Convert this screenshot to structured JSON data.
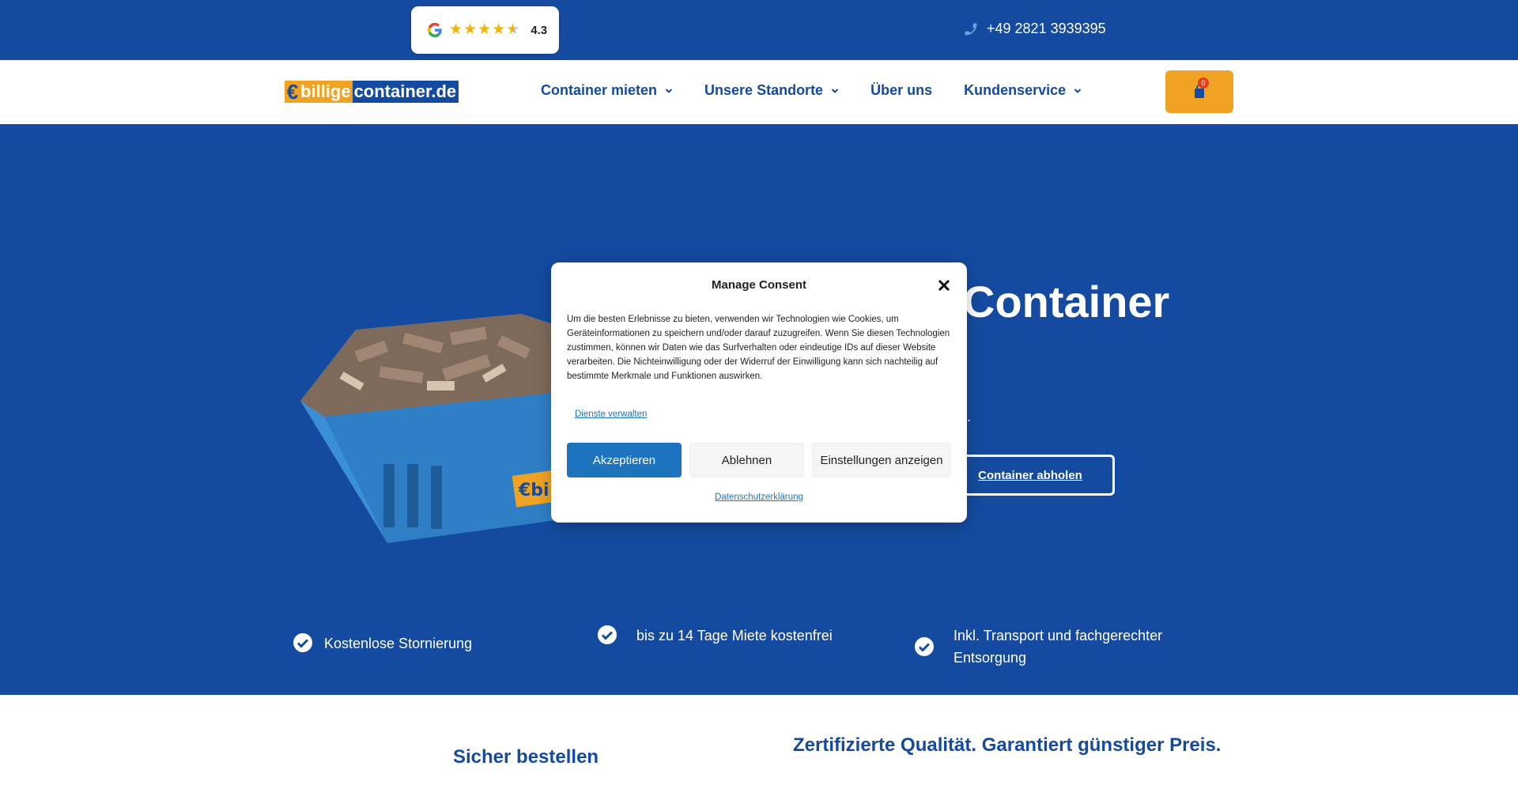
{
  "topbar": {
    "rating": "4.3",
    "phone": "+49 2821 3939395"
  },
  "header": {
    "logo_part1": "billige",
    "logo_part2": "container.de",
    "nav": [
      {
        "label": "Container mieten",
        "has_dropdown": true
      },
      {
        "label": "Unsere Standorte",
        "has_dropdown": true
      },
      {
        "label": "Über uns",
        "has_dropdown": false
      },
      {
        "label": "Kundenservice",
        "has_dropdown": true
      }
    ],
    "cart_count": "0"
  },
  "hero": {
    "title_visible": "Container",
    "subtitle_visible": "eis.",
    "button_label": "Container abholen"
  },
  "features": [
    "Kostenlose Stornierung",
    "bis zu 14 Tage Miete kostenfrei",
    "Inkl. Transport und fachgerechter Entsorgung"
  ],
  "below": {
    "left_heading": "Sicher bestellen",
    "right_heading": "Zertifizierte Qualität. Garantiert günstiger Preis."
  },
  "consent": {
    "title": "Manage Consent",
    "text": "Um die besten Erlebnisse zu bieten, verwenden wir Technologien wie Cookies, um Geräteinformationen zu speichern und/oder darauf zuzugreifen. Wenn Sie diesen Technologien zustimmen, können wir Daten wie das Surfverhalten oder eindeutige IDs auf dieser Website verarbeiten. Die Nichteinwilligung oder der Widerruf der Einwilligung kann sich nachteilig auf bestimmte Merkmale und Funktionen auswirken.",
    "manage_link": "Dienste verwalten",
    "accept": "Akzeptieren",
    "deny": "Ablehnen",
    "settings": "Einstellungen anzeigen",
    "privacy_link": "Datenschutzerklärung"
  },
  "colors": {
    "brand_blue": "#144ba0",
    "brand_orange": "#f0a322",
    "accept_blue": "#1e73be"
  }
}
